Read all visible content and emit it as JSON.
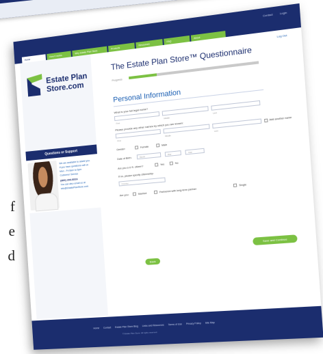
{
  "side_text": [
    "f",
    "e",
    "d"
  ],
  "top_links": [
    "Contact",
    "Login"
  ],
  "nav_tabs": [
    "Home",
    "How it works",
    "Why Estate Plan Store",
    "Products",
    "Resources",
    "FAQ",
    "About"
  ],
  "log_link": "Log Out",
  "logo": {
    "line1": "Estate Plan",
    "line2": "Store.com"
  },
  "support": {
    "title": "Questions or Support",
    "lines": [
      "We are available to assist you.",
      "If you have questions call us",
      "Mon - Fri 8am to 5pm",
      "Customer Service"
    ],
    "phone": "(800) 294-8316",
    "email_lines": [
      "You can also email us at",
      "info@EstatePlanStore.com"
    ]
  },
  "main": {
    "title": "The Estate Plan Store™ Questionnaire",
    "progress_label": "Progress",
    "progress_value": 0.22,
    "section_title": "Personal Information",
    "q1": "What is your full legal name?",
    "name_caps": [
      "First",
      "Middle",
      "Last"
    ],
    "q2": "Please provide any other names by which you are known:",
    "also_known_caps": [
      "First",
      "Middle",
      "Last"
    ],
    "also_known_opt": "Add another name",
    "gender_label": "Gender:",
    "gender_opts": [
      "Female",
      "Male"
    ],
    "dob_label": "Date of Birth:",
    "dob_caps": [
      "Month",
      "Day",
      "Year"
    ],
    "citizen_label": "Are you a U.S. citizen?",
    "citizen_opts": [
      "Yes",
      "No"
    ],
    "country_label": "If no, please specify citizenship:",
    "country_placeholder": "Country",
    "marital_label": "Are you:",
    "marital_opts": [
      "Married",
      "Partnered with long-term partner",
      "Single"
    ],
    "back_button": "Back",
    "save_button": "Save and Continue"
  },
  "footer": {
    "links": [
      "Home",
      "Contact",
      "Estate Plan Store Blog",
      "Links and Resources",
      "Terms of Use",
      "Privacy Policy",
      "Site Map"
    ],
    "copyright": "© Estate Plan Store. All rights reserved."
  }
}
